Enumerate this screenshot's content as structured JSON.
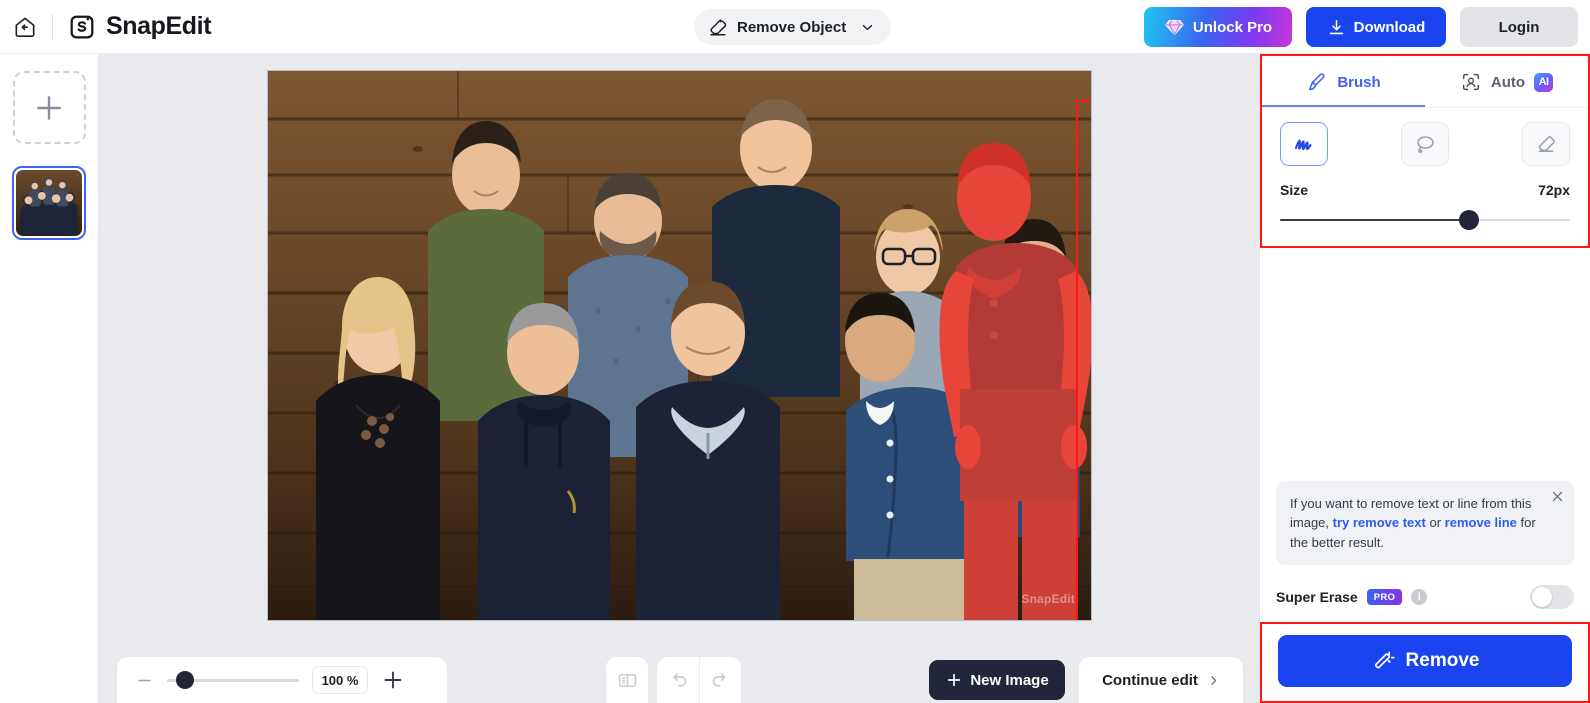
{
  "header": {
    "back_icon": "back-arrow-home-icon",
    "brand": "SnapEdit",
    "mode": {
      "label": "Remove Object",
      "icon": "eraser-icon",
      "chevron": "chevron-down-icon"
    },
    "unlock_pro": {
      "label": "Unlock Pro",
      "icon": "diamond-icon",
      "color": "#7b3bf0"
    },
    "download": {
      "label": "Download",
      "icon": "download-icon",
      "color": "#1a44ef"
    },
    "login": {
      "label": "Login",
      "color": "#e3e4e8"
    }
  },
  "rail": {
    "add_label": "+",
    "add_icon": "plus-icon",
    "thumbnail_alt": "group-photo-thumbnail"
  },
  "canvas": {
    "watermark": "SnapEdit",
    "selection_color": "#ff1616",
    "mask_color": "#e8332a",
    "zoom": {
      "value": "100 %",
      "minus_icon": "minus-icon",
      "plus_icon": "plus-icon",
      "slider_percent": 8
    },
    "compare_icon": "compare-split-icon",
    "undo_icon": "undo-icon",
    "redo_icon": "redo-icon",
    "new_image": {
      "label": "New Image",
      "icon": "plus-icon"
    },
    "continue_edit": {
      "label": "Continue edit",
      "icon": "chevron-right-icon"
    }
  },
  "panel": {
    "tabs": [
      {
        "label": "Brush",
        "icon": "brush-icon",
        "active": true
      },
      {
        "label": "Auto",
        "icon": "face-detect-icon",
        "badge": "AI",
        "active": false
      }
    ],
    "tools": [
      {
        "name": "brush-tool",
        "icon": "scribble-icon",
        "active": true
      },
      {
        "name": "lasso-tool",
        "icon": "lasso-icon",
        "active": false
      },
      {
        "name": "eraser-tool",
        "icon": "eraser-icon",
        "active": false
      }
    ],
    "size": {
      "label": "Size",
      "value": "72px",
      "percent": 65
    },
    "hint": {
      "text_before": "If you want to remove text or line from this image, ",
      "link1": "try remove text",
      "text_middle": " or ",
      "link2": "remove line",
      "text_after": " for the better result.",
      "close_icon": "close-icon"
    },
    "super_erase": {
      "label": "Super Erase",
      "badge": "PRO",
      "info_icon": "info-icon",
      "enabled": false
    },
    "remove_button": {
      "label": "Remove",
      "icon": "magic-wand-icon",
      "color": "#1a44ef"
    }
  }
}
